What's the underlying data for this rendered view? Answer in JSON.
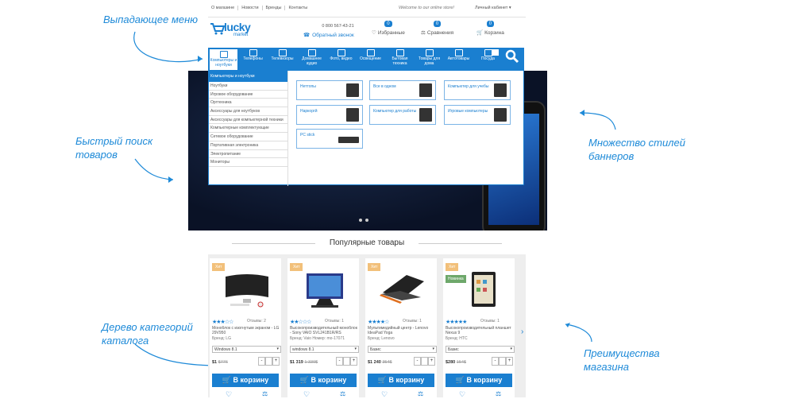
{
  "annotations": {
    "dropdown": "Выпадающее меню",
    "search": "Быстрый поиск товаров",
    "banners": "Множество стилей баннеров",
    "tree": "Дерево категорий каталога",
    "advantages": "Преимущества магазина"
  },
  "topbar": {
    "links": [
      "О магазине",
      "Новости",
      "Бренды",
      "Контакты"
    ],
    "welcome": "Welcome to our online store!",
    "account": "Личный кабинет ▾"
  },
  "header": {
    "logo_text": "lucky",
    "logo_sub": "market",
    "phone": "0 800 567-43-21",
    "callback": "Обратный звонок",
    "favorites": {
      "count": "0",
      "label": "Избранные"
    },
    "compare": {
      "count": "0",
      "label": "Сравнения"
    },
    "cart": {
      "count": "0",
      "label": "Корзина"
    }
  },
  "nav": [
    "Компьютеры и ноутбуки",
    "Телефоны",
    "Телевизоры",
    "Домашнее аудио",
    "Фото, видео",
    "Освещение",
    "Бытовая техника",
    "Товары для дома",
    "Автотовары",
    "Посуда"
  ],
  "mega": {
    "header": "Компьютеры и ноутбуки",
    "left": [
      "Ноутбуки",
      "Игровое оборудование",
      "Оргтехника",
      "Аксессуары для ноутбуков",
      "Аксессуары для компьютерной техники",
      "Компьютерные комплектующие",
      "Сетевое оборудование",
      "Портативная электроника",
      "Электропитание",
      "Мониторы"
    ],
    "cards": [
      "Неттопы",
      "Все в одном",
      "Компьютер для учебы",
      "Наркоргй",
      "Компьютер для работы",
      "Игровые компьютеры",
      "PC stick"
    ]
  },
  "section_title": "Популярные товары",
  "products": [
    {
      "tag": "Хит",
      "stars": "★★★☆☆",
      "reviews": "Отзывы: 2",
      "name": "Моноблок с изогнутым экраном - LG 29V950",
      "brand": "Бренд: LG",
      "option": "Windows 8.1",
      "price": "$1 ",
      "old": "$776"
    },
    {
      "tag": "Хит",
      "stars": "★★☆☆☆",
      "reviews": "Отзывы: 1",
      "name": "Высокопроизводительный моноблок - Sony VAIO SVL241B1R/RS",
      "brand": "Бренд: Vaio Номер: mo-17071",
      "option": "windows 8.1",
      "price": "$1 319",
      "old": "1 339$"
    },
    {
      "tag": "Хит",
      "stars": "★★★★☆",
      "reviews": "Отзывы: 1",
      "name": "Мультимедийный центр - Lenovo IdeaPad Yoga",
      "brand": "Бренд: Lenovo",
      "option": "Базис",
      "price": "$1 240",
      "old": "354$"
    },
    {
      "tag": "Хит",
      "tag2": "Новинка",
      "stars": "★★★★★",
      "reviews": "Отзывы: 1",
      "name": "Высокопроизводительный планшет Nexus 9",
      "brand": "Бренд: HTC",
      "option": "Базис",
      "price": "$280",
      "old": "154$"
    }
  ],
  "buy_label": "В корзину"
}
